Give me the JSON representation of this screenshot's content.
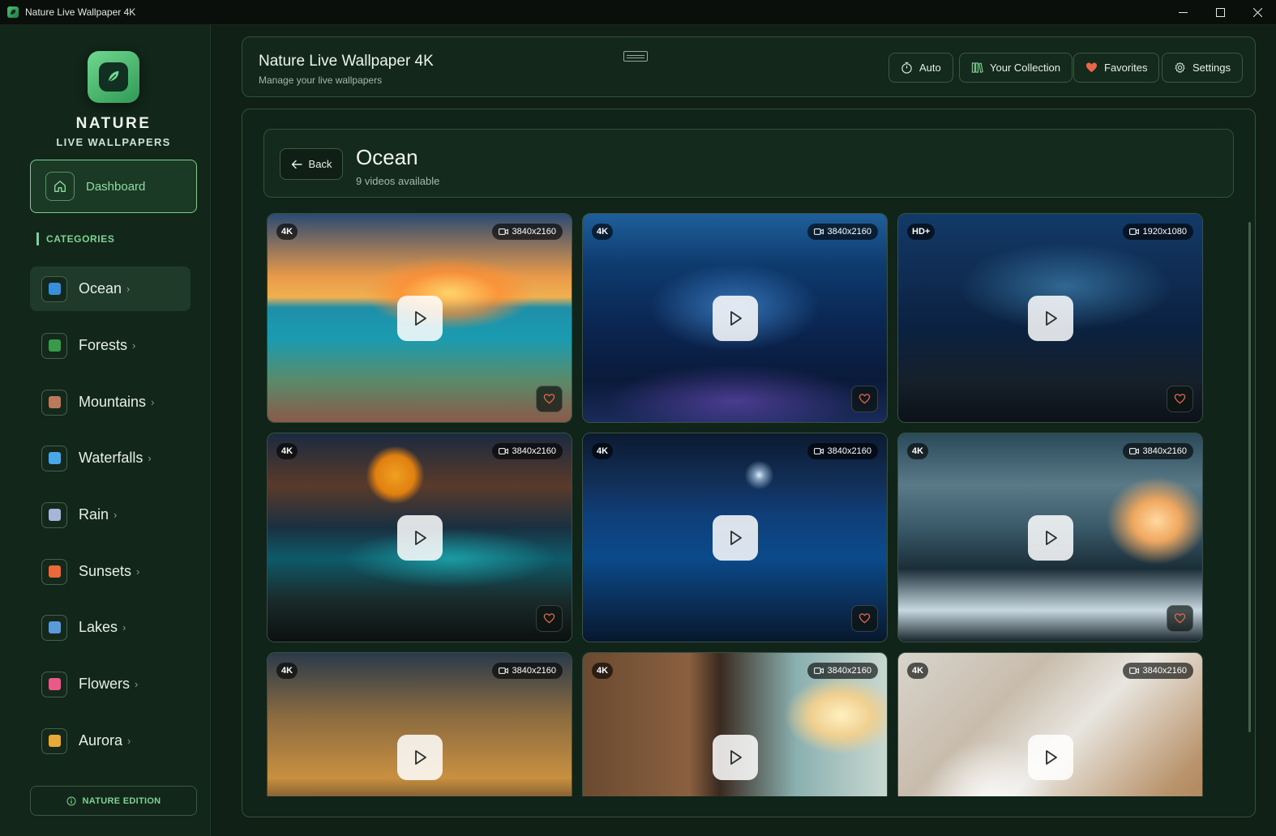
{
  "window": {
    "title": "Nature Live Wallpaper 4K"
  },
  "sidebar": {
    "brand_title": "NATURE",
    "brand_subtitle": "LIVE WALLPAPERS",
    "dashboard_label": "Dashboard",
    "categories_heading": "CATEGORIES",
    "items": [
      {
        "label": "Ocean",
        "icon": "wave-icon",
        "active": true,
        "color": "#3a8fd9"
      },
      {
        "label": "Forests",
        "icon": "tree-icon",
        "active": false,
        "color": "#3a9a4a"
      },
      {
        "label": "Mountains",
        "icon": "mountain-icon",
        "active": false,
        "color": "#b97a5a"
      },
      {
        "label": "Waterfalls",
        "icon": "droplet-icon",
        "active": false,
        "color": "#4aa8e8"
      },
      {
        "label": "Rain",
        "icon": "rain-cloud-icon",
        "active": false,
        "color": "#a8b4d8"
      },
      {
        "label": "Sunsets",
        "icon": "sunset-icon",
        "active": false,
        "color": "#e86a3a"
      },
      {
        "label": "Lakes",
        "icon": "lake-icon",
        "active": false,
        "color": "#5a9ad8"
      },
      {
        "label": "Flowers",
        "icon": "flower-icon",
        "active": false,
        "color": "#e85a8a"
      },
      {
        "label": "Aurora",
        "icon": "sparkles-icon",
        "active": false,
        "color": "#e8a83a"
      }
    ],
    "edition_label": "NATURE EDITION"
  },
  "header": {
    "title": "Nature Live Wallpaper 4K",
    "subtitle": "Manage your live wallpapers",
    "auto_label": "Auto",
    "collection_label": "Your Collection",
    "favorites_label": "Favorites",
    "settings_label": "Settings"
  },
  "category": {
    "back_label": "Back",
    "title": "Ocean",
    "count_text": "9 videos available"
  },
  "videos": [
    {
      "quality": "4K",
      "resolution": "3840x2160",
      "scene": "tropical-reef-sunset"
    },
    {
      "quality": "4K",
      "resolution": "3840x2160",
      "scene": "underwater-bioluminescent-reef"
    },
    {
      "quality": "HD+",
      "resolution": "1920x1080",
      "scene": "glowing-ocean-floor"
    },
    {
      "quality": "4K",
      "resolution": "3840x2160",
      "scene": "moonrise-rocky-shore"
    },
    {
      "quality": "4K",
      "resolution": "3840x2160",
      "scene": "night-iceberg-underwater"
    },
    {
      "quality": "4K",
      "resolution": "3840x2160",
      "scene": "ice-cave-sunset"
    },
    {
      "quality": "4K",
      "resolution": "3840x2160",
      "scene": "pirate-ship-sunset"
    },
    {
      "quality": "4K",
      "resolution": "3840x2160",
      "scene": "sea-cave-beach"
    },
    {
      "quality": "4K",
      "resolution": "3840x2160",
      "scene": "foam-on-sand"
    }
  ],
  "colors": {
    "accent": "#6fd88f",
    "favorite": "#e8674a",
    "background": "#112017"
  }
}
